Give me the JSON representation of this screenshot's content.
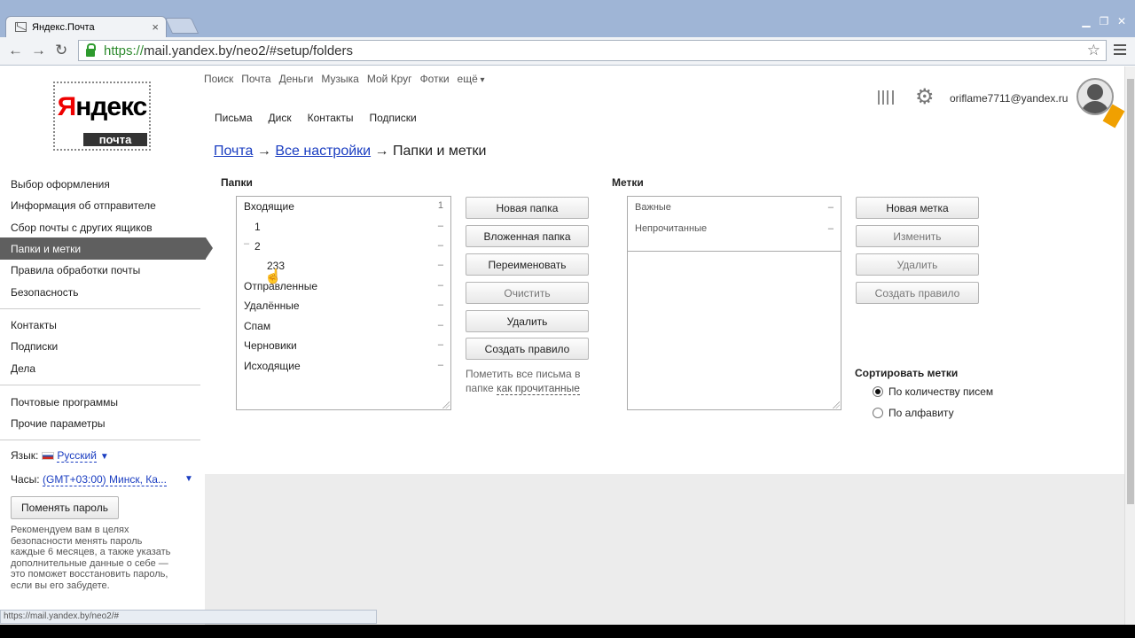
{
  "browser": {
    "tab_title": "Яндекс.Почта",
    "tab_close": "×",
    "url_scheme": "https://",
    "url_rest": "mail.yandex.by/neo2/#setup/folders",
    "win_min": "▁",
    "win_restore": "❐",
    "win_close": "✕",
    "back": "←",
    "forward": "→",
    "reload": "↻",
    "star": "☆",
    "status_url": "https://mail.yandex.by/neo2/#"
  },
  "logo": {
    "brand_first": "Я",
    "brand_rest": "ндекс",
    "sub": "почта"
  },
  "top_nav": [
    "Поиск",
    "Почта",
    "Деньги",
    "Музыка",
    "Мой Круг",
    "Фотки",
    "ещё"
  ],
  "sub_nav": [
    "Письма",
    "Диск",
    "Контакты",
    "Подписки"
  ],
  "user": {
    "email": "oriflame7711@yandex.ru"
  },
  "sidebar": {
    "items": [
      "Выбор оформления",
      "Информация об отправителе",
      "Сбор почты с других ящиков",
      "Папки и метки",
      "Правила обработки почты",
      "Безопасность"
    ],
    "items2": [
      "Контакты",
      "Подписки",
      "Дела"
    ],
    "items3": [
      "Почтовые программы",
      "Прочие параметры"
    ],
    "lang_label": "Язык:",
    "lang_value": "Русский",
    "clock_label": "Часы:",
    "clock_value": "(GMT+03:00) Минск, Ка...",
    "change_password": "Поменять пароль",
    "hint": [
      "Рекомендуем вам в целях",
      "безопасности менять пароль",
      "каждые 6 месяцев, а также указать",
      "дополнительные данные о себе —",
      "это поможет восстановить пароль,",
      "если вы его забудете."
    ]
  },
  "breadcrumb": {
    "part1": "Почта",
    "arrow1": "→",
    "part2": "Все настройки",
    "arrow2": "→",
    "current": "Папки и метки"
  },
  "folders": {
    "title": "Папки",
    "rows": [
      {
        "name": "Входящие",
        "count": "1"
      },
      {
        "name": "1",
        "count": "–"
      },
      {
        "name": "2",
        "count": "–",
        "toggle": "–"
      },
      {
        "name": "233",
        "count": "–"
      },
      {
        "name": "Отправленные",
        "count": "–"
      },
      {
        "name": "Удалённые",
        "count": "–"
      },
      {
        "name": "Спам",
        "count": "–"
      },
      {
        "name": "Черновики",
        "count": "–"
      },
      {
        "name": "Исходящие",
        "count": "–"
      }
    ],
    "buttons": [
      "Новая папка",
      "Вложенная папка",
      "Переименовать",
      "Очистить",
      "Удалить",
      "Создать правило"
    ],
    "mark_all_1": "Пометить все письма в",
    "mark_all_2": "папке",
    "mark_all_link": "как прочитанные"
  },
  "labels": {
    "title": "Метки",
    "rows": [
      {
        "name": "Важные",
        "count": "–"
      },
      {
        "name": "Непрочитанные",
        "count": "–"
      }
    ],
    "buttons": [
      "Новая метка",
      "Изменить",
      "Удалить",
      "Создать правило"
    ],
    "sort_title": "Сортировать метки",
    "sort_options": [
      "По количеству писем",
      "По алфавиту"
    ],
    "sort_selected": 0
  }
}
